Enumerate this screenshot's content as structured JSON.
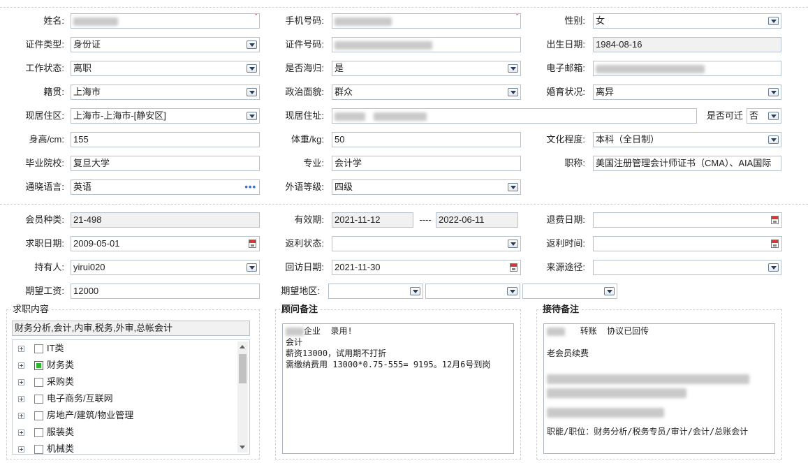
{
  "personal": {
    "name_label": "姓名:",
    "phone_label": "手机号码:",
    "gender_label": "性别:",
    "gender": "女",
    "id_type_label": "证件类型:",
    "id_type": "身份证",
    "id_no_label": "证件号码:",
    "birth_label": "出生日期:",
    "birth": "1984-08-16",
    "work_status_label": "工作状态:",
    "work_status": "离职",
    "returnee_label": "是否海归:",
    "returnee": "是",
    "email_label": "电子邮箱:",
    "native_label": "籍贯:",
    "native": "上海市",
    "political_label": "政治面貌:",
    "political": "群众",
    "marital_label": "婚育状况:",
    "marital": "离异",
    "residence_area_label": "现居住区:",
    "residence_area": "上海市-上海市-[静安区]",
    "residence_addr_label": "现居住址:",
    "relocate_label": "是否可迁",
    "relocate": "否",
    "height_label": "身高/cm:",
    "height": "155",
    "weight_label": "体重/kg:",
    "weight": "50",
    "education_label": "文化程度:",
    "education": "本科（全日制）",
    "school_label": "毕业院校:",
    "school": "复旦大学",
    "major_label": "专业:",
    "major": "会计学",
    "title_label": "职称:",
    "title": "美国注册管理会计师证书（CMA）、AIA国际",
    "language_label": "通晓语言:",
    "language": "英语",
    "language_more": "•••",
    "foreign_level_label": "外语等级:",
    "foreign_level": "四级"
  },
  "member": {
    "type_label": "会员种类:",
    "type": "21-498",
    "validity_label": "有效期:",
    "valid_from": "2021-11-12",
    "range_sep": "----",
    "valid_to": "2022-06-11",
    "refund_date_label": "退费日期:",
    "job_date_label": "求职日期:",
    "job_date": "2009-05-01",
    "rebate_status_label": "返利状态:",
    "rebate_time_label": "返利时间:",
    "holder_label": "持有人:",
    "holder": "yirui020",
    "revisit_label": "回访日期:",
    "revisit": "2021-11-30",
    "source_label": "来源途径:",
    "salary_label": "期望工资:",
    "salary": "12000",
    "region_label": "期望地区:"
  },
  "job_content": {
    "title": "求职内容",
    "summary": "财务分析,会计,内审,税务,外审,总帐会计",
    "tree": [
      {
        "label": "IT类",
        "checked": false
      },
      {
        "label": "财务类",
        "checked": true
      },
      {
        "label": "采购类",
        "checked": false
      },
      {
        "label": "电子商务/互联网",
        "checked": false
      },
      {
        "label": "房地产/建筑/物业管理",
        "checked": false
      },
      {
        "label": "服装类",
        "checked": false
      },
      {
        "label": "机械类",
        "checked": false
      }
    ]
  },
  "consultant_note": {
    "title": "顾问备注",
    "line1": "企业  录用!",
    "line2": "会计",
    "line3": "薪资13000，试用期不打折",
    "line4": "需缴纳费用 13000*0.75-555= 9195。12月6号到岗"
  },
  "reception_note": {
    "title": "接待备注",
    "line1": "转账  协议已回传",
    "line2": "老会员续费",
    "line3": "职能/职位：财务分析/税务专员/审计/会计/总账会计"
  },
  "colors": {
    "border": "#b7c2cf",
    "readonly_bg": "#f1f1f1",
    "required": "#e03030",
    "checked": "#2fb52f"
  }
}
